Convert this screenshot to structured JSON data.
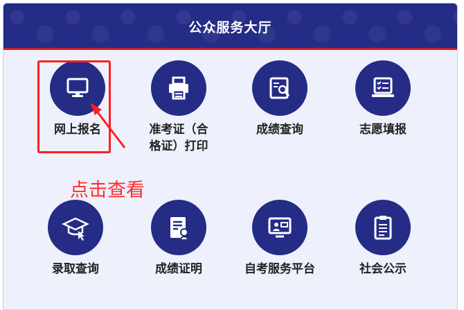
{
  "header": {
    "title": "公众服务大厅"
  },
  "tiles": [
    {
      "label": "网上报名"
    },
    {
      "label": "准考证（合\n格证）打印"
    },
    {
      "label": "成绩查询"
    },
    {
      "label": "志愿填报"
    },
    {
      "label": "录取查询"
    },
    {
      "label": "成绩证明"
    },
    {
      "label": "自考服务平台"
    },
    {
      "label": "社会公示"
    }
  ],
  "annotation": {
    "text": "点击查看"
  },
  "colors": {
    "primary": "#242c86",
    "accent": "#c81d2a",
    "annotation": "#ff2d2d",
    "background": "#eef0fb"
  },
  "icons": [
    "monitor-icon",
    "printer-icon",
    "score-search-icon",
    "checklist-laptop-icon",
    "graduation-cap-icon",
    "certificate-icon",
    "video-screen-icon",
    "clipboard-icon"
  ]
}
